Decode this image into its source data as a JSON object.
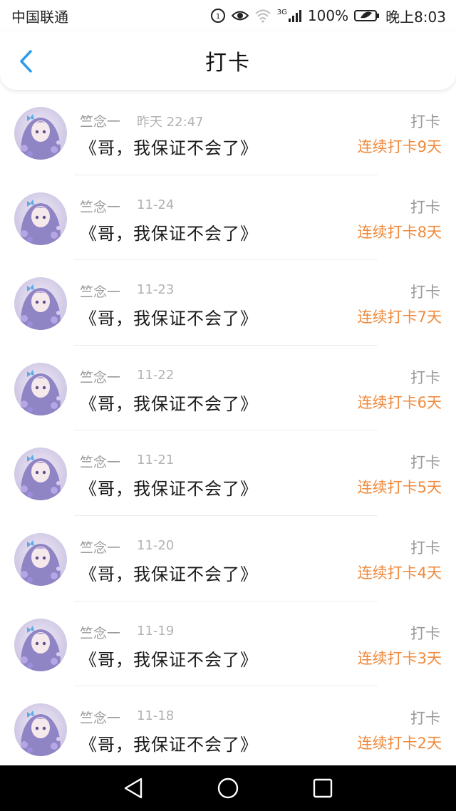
{
  "status_bar": {
    "carrier": "中国联通",
    "network": "3G",
    "battery": "100%",
    "time": "晚上8:03"
  },
  "navbar": {
    "title": "打卡",
    "back_icon": "chevron-left-icon"
  },
  "colors": {
    "accent_blue": "#2f9bea",
    "streak_orange": "#f08a3c",
    "muted_gray": "#9a9a9a"
  },
  "records": [
    {
      "name": "竺念一",
      "time": "昨天 22:47",
      "content": "《哥，我保证不会了》",
      "tag": "打卡",
      "streak": "连续打卡9天"
    },
    {
      "name": "竺念一",
      "time": "11-24",
      "content": "《哥，我保证不会了》",
      "tag": "打卡",
      "streak": "连续打卡8天"
    },
    {
      "name": "竺念一",
      "time": "11-23",
      "content": "《哥，我保证不会了》",
      "tag": "打卡",
      "streak": "连续打卡7天"
    },
    {
      "name": "竺念一",
      "time": "11-22",
      "content": "《哥，我保证不会了》",
      "tag": "打卡",
      "streak": "连续打卡6天"
    },
    {
      "name": "竺念一",
      "time": "11-21",
      "content": "《哥，我保证不会了》",
      "tag": "打卡",
      "streak": "连续打卡5天"
    },
    {
      "name": "竺念一",
      "time": "11-20",
      "content": "《哥，我保证不会了》",
      "tag": "打卡",
      "streak": "连续打卡4天"
    },
    {
      "name": "竺念一",
      "time": "11-19",
      "content": "《哥，我保证不会了》",
      "tag": "打卡",
      "streak": "连续打卡3天"
    },
    {
      "name": "竺念一",
      "time": "11-18",
      "content": "《哥，我保证不会了》",
      "tag": "打卡",
      "streak": "连续打卡2天"
    }
  ],
  "system_nav": {
    "back": "triangle-back-icon",
    "home": "circle-home-icon",
    "recents": "square-recents-icon"
  }
}
